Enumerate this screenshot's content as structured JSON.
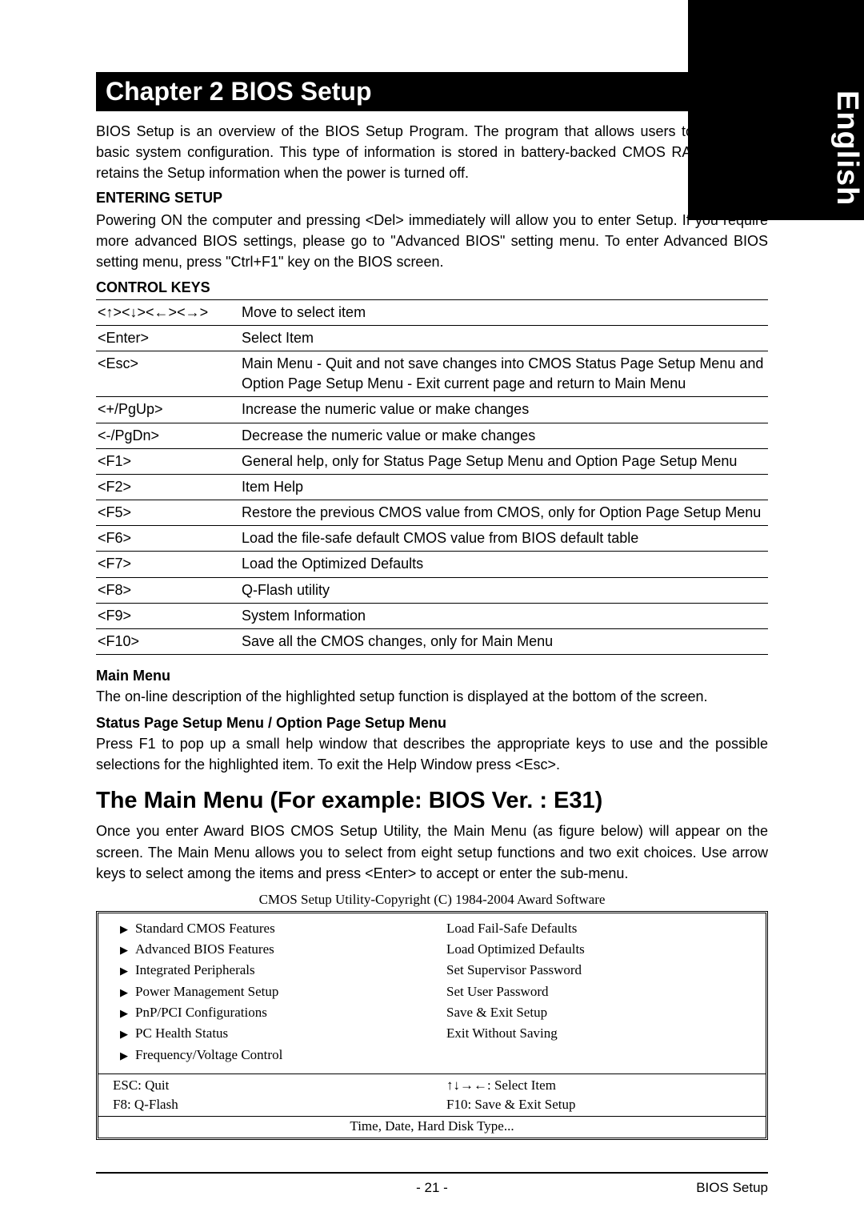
{
  "side_label": "English",
  "chapter_title": "Chapter 2  BIOS Setup",
  "intro": "BIOS Setup is an overview of the BIOS Setup Program. The program that allows users to modify the basic system configuration. This type of information is stored in battery-backed CMOS RAM so that it retains the Setup information when the power is turned off.",
  "entering_head": "ENTERING SETUP",
  "entering_p1": "Powering ON the computer and pressing <Del> immediately will allow you to enter Setup. If you require more advanced BIOS settings, please go to \"Advanced BIOS\" setting menu. To enter Advanced BIOS setting menu, press \"Ctrl+F1\" key on the BIOS screen.",
  "control_head": "CONTROL KEYS",
  "keys": [
    {
      "k": "<↑><↓><←><→>",
      "d": "Move to select item"
    },
    {
      "k": "<Enter>",
      "d": "Select Item"
    },
    {
      "k": "<Esc>",
      "d": "Main Menu - Quit and not save changes into CMOS Status Page Setup Menu and Option Page Setup Menu - Exit current page and return to Main Menu"
    },
    {
      "k": "<+/PgUp>",
      "d": "Increase the numeric value or make changes"
    },
    {
      "k": "<-/PgDn>",
      "d": "Decrease the numeric value or make changes"
    },
    {
      "k": "<F1>",
      "d": "General help, only for Status Page Setup Menu and Option Page Setup Menu"
    },
    {
      "k": "<F2>",
      "d": "Item Help"
    },
    {
      "k": "<F5>",
      "d": "Restore the previous CMOS value from CMOS, only for Option Page Setup Menu"
    },
    {
      "k": "<F6>",
      "d": "Load the file-safe default CMOS value from BIOS default table"
    },
    {
      "k": "<F7>",
      "d": "Load the Optimized Defaults"
    },
    {
      "k": "<F8>",
      "d": "Q-Flash utility"
    },
    {
      "k": "<F9>",
      "d": "System Information"
    },
    {
      "k": "<F10>",
      "d": "Save all the CMOS changes, only for Main Menu"
    }
  ],
  "mainmenu_head": "Main Menu",
  "mainmenu_text": "The on-line description of the highlighted setup function is displayed at the bottom of the screen.",
  "status_head": "Status Page Setup Menu / Option Page Setup Menu",
  "status_text": "Press F1 to pop up a small help window that describes the appropriate keys to use and the possible selections for the highlighted item. To exit the Help Window press <Esc>.",
  "mainmenu_title": "The Main Menu (For example: BIOS Ver. : E31)",
  "mainmenu_desc": "Once you enter Award BIOS CMOS Setup Utility, the Main Menu (as figure below) will appear on the screen. The Main Menu allows you to select from eight setup functions and two exit choices. Use arrow keys to select among the items and press <Enter> to accept or enter the sub-menu.",
  "cmos_caption": "CMOS Setup Utility-Copyright (C) 1984-2004 Award Software",
  "cmos_left": [
    "Standard CMOS Features",
    "Advanced BIOS Features",
    "Integrated Peripherals",
    "Power Management Setup",
    "PnP/PCI Configurations",
    "PC Health Status",
    "Frequency/Voltage Control"
  ],
  "cmos_right": [
    "Load Fail-Safe Defaults",
    "Load Optimized Defaults",
    "Set Supervisor Password",
    "Set User Password",
    "Save & Exit Setup",
    "Exit Without Saving"
  ],
  "cmos_mid_left": [
    "ESC: Quit",
    "F8: Q-Flash"
  ],
  "cmos_mid_right": [
    "↑↓→←: Select Item",
    "F10: Save & Exit Setup"
  ],
  "cmos_bottom": "Time, Date, Hard Disk Type...",
  "footer_page": "- 21 -",
  "footer_label": "BIOS Setup"
}
